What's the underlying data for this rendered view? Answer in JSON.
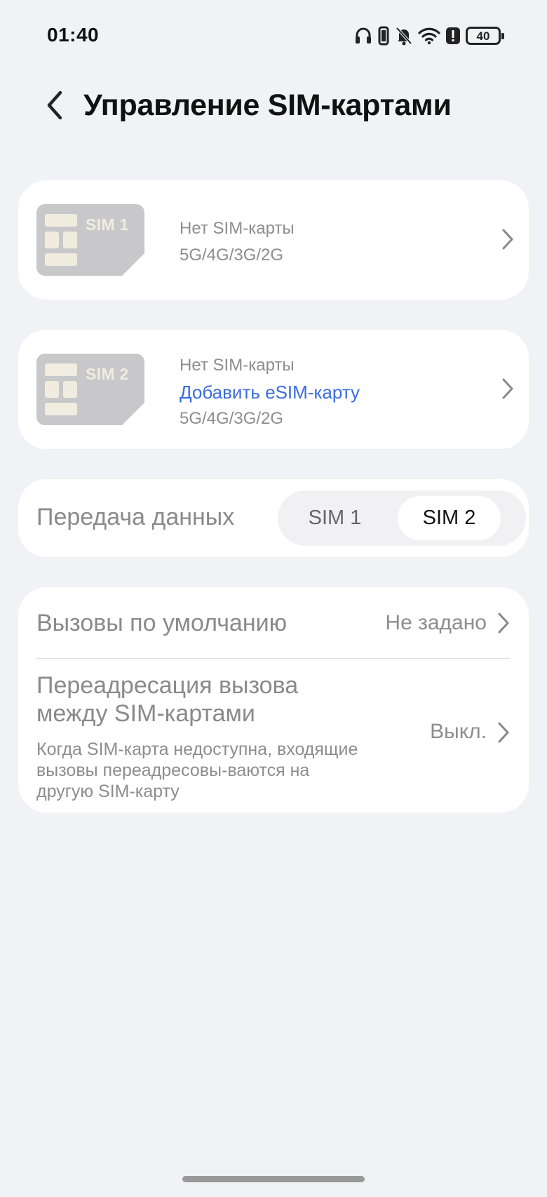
{
  "status_bar": {
    "time": "01:40",
    "battery": "40",
    "icons": [
      "headphones-icon",
      "vibrate-icon",
      "bell-off-icon",
      "wifi-icon",
      "alert-icon",
      "battery-icon"
    ]
  },
  "header": {
    "title": "Управление SIM-картами"
  },
  "sim_cards": [
    {
      "chip_label": "SIM 1",
      "status": "Нет SIM-карты",
      "networks": "5G/4G/3G/2G"
    },
    {
      "chip_label": "SIM 2",
      "status": "Нет SIM-карты",
      "add_link": "Добавить eSIM-карту",
      "networks": "5G/4G/3G/2G"
    }
  ],
  "data_transfer": {
    "label": "Передача данных",
    "options": [
      "SIM 1",
      "SIM 2"
    ],
    "selected": "SIM 2"
  },
  "calls": {
    "default": {
      "title": "Вызовы по умолчанию",
      "value": "Не задано"
    },
    "forwarding": {
      "title": "Переадресация вызова между SIM-картами",
      "description": "Когда SIM-карта недоступна, входящие вызовы переадресовы-ваются на другую SIM-карту",
      "value": "Выкл."
    }
  },
  "colors": {
    "background": "#f0f2f6",
    "card": "#ffffff",
    "link": "#3a6be0",
    "muted_text": "#8a8a8a",
    "sim_chip": "#c8c8ca"
  }
}
